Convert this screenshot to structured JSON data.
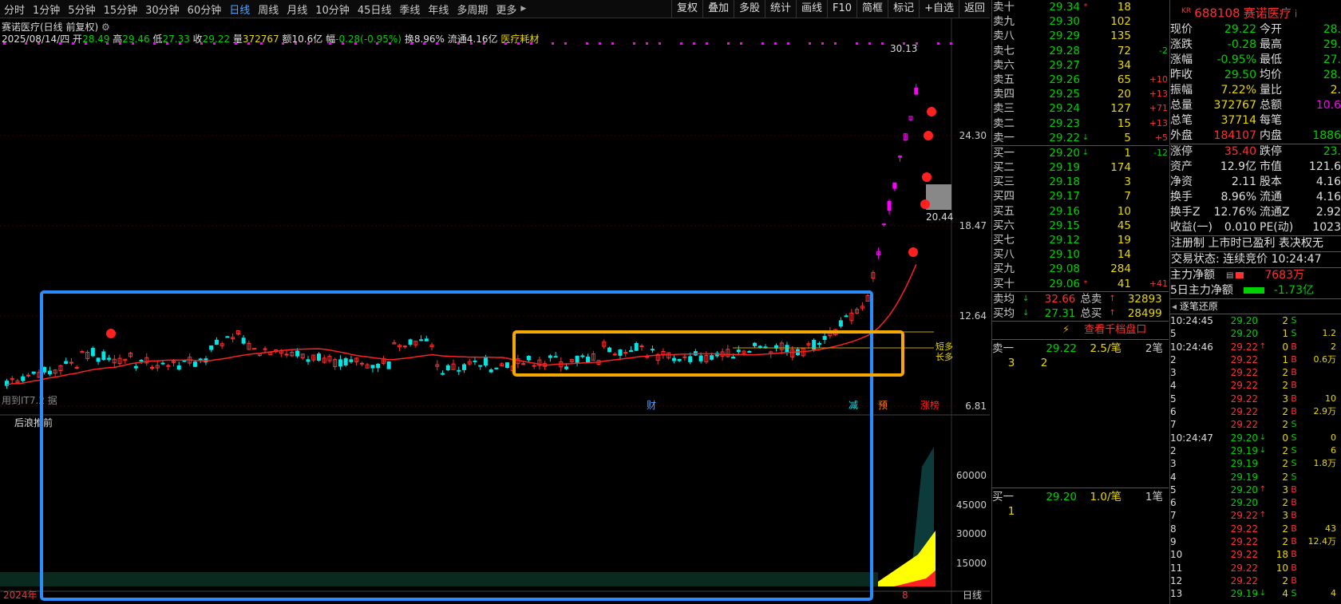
{
  "toolbar": {
    "timeframes": [
      "分时",
      "1分钟",
      "5分钟",
      "15分钟",
      "30分钟",
      "60分钟",
      "日线",
      "周线",
      "月线",
      "10分钟",
      "45日线",
      "季线",
      "年线",
      "多周期",
      "更多"
    ],
    "active_timeframe": "日线",
    "more_arrow": "▶",
    "tools": [
      "复权",
      "叠加",
      "多股",
      "统计",
      "画线",
      "F10",
      "简框",
      "标记",
      "+自选",
      "返回"
    ]
  },
  "chart_header": {
    "title": "赛诺医疗(日线 前复权)",
    "date": "2025/08/14/四",
    "open_label": "开",
    "open": "28.49",
    "high_label": "高",
    "high": "29.46",
    "low_label": "低",
    "low": "27.33",
    "close_label": "收",
    "close": "29.22",
    "vol_label": "量",
    "vol": "372767",
    "amount_label": "额",
    "amount": "10.6亿",
    "chg_label": "幅",
    "chg": "-0.28(-0.95%)",
    "turnover_label": "换",
    "turnover": "8.96%",
    "float_label": "流通",
    "float": "4.16亿",
    "sector": "医疗耗材"
  },
  "chart": {
    "y_ticks": [
      "24.30",
      "18.47",
      "12.64",
      "6.81"
    ],
    "peak_label": "30.13",
    "low_label": "20.44",
    "x_start": "2024年",
    "x_mark": "8",
    "event_cai": "财",
    "event_jian": "减",
    "event_yu": "预",
    "event_zt": "涨榜",
    "bottom_text": "用到IT7.2 据",
    "lower_title": "后浪推前",
    "lower_y_ticks": [
      "60000",
      "45000",
      "30000",
      "15000"
    ],
    "side_labels": [
      "短多",
      "长多"
    ],
    "footer_right": "日线",
    "colors": {
      "up": "#ff3030",
      "down": "#00e5e5",
      "ma": "#ff2020",
      "box_blue": "#2a8cff",
      "box_orange": "#f5a800"
    }
  },
  "order_book": {
    "sells": [
      {
        "label": "卖十",
        "price": "29.34",
        "arr": "*",
        "vol": "18",
        "chg": ""
      },
      {
        "label": "卖九",
        "price": "29.30",
        "arr": "",
        "vol": "102",
        "chg": ""
      },
      {
        "label": "卖八",
        "price": "29.29",
        "arr": "",
        "vol": "135",
        "chg": ""
      },
      {
        "label": "卖七",
        "price": "29.28",
        "arr": "",
        "vol": "72",
        "chg": "-2"
      },
      {
        "label": "卖六",
        "price": "29.27",
        "arr": "",
        "vol": "34",
        "chg": ""
      },
      {
        "label": "卖五",
        "price": "29.26",
        "arr": "",
        "vol": "65",
        "chg": "+10"
      },
      {
        "label": "卖四",
        "price": "29.25",
        "arr": "",
        "vol": "20",
        "chg": "+13"
      },
      {
        "label": "卖三",
        "price": "29.24",
        "arr": "",
        "vol": "127",
        "chg": "+71"
      },
      {
        "label": "卖二",
        "price": "29.23",
        "arr": "",
        "vol": "15",
        "chg": "+13"
      },
      {
        "label": "卖一",
        "price": "29.22",
        "arr": "↓",
        "vol": "5",
        "chg": "+5"
      }
    ],
    "buys": [
      {
        "label": "买一",
        "price": "29.20",
        "arr": "↓",
        "vol": "1",
        "chg": "-12"
      },
      {
        "label": "买二",
        "price": "29.19",
        "arr": "",
        "vol": "174",
        "chg": ""
      },
      {
        "label": "买三",
        "price": "29.18",
        "arr": "",
        "vol": "3",
        "chg": ""
      },
      {
        "label": "买四",
        "price": "29.17",
        "arr": "",
        "vol": "7",
        "chg": ""
      },
      {
        "label": "买五",
        "price": "29.16",
        "arr": "",
        "vol": "10",
        "chg": ""
      },
      {
        "label": "买六",
        "price": "29.15",
        "arr": "",
        "vol": "45",
        "chg": ""
      },
      {
        "label": "买七",
        "price": "29.12",
        "arr": "",
        "vol": "19",
        "chg": ""
      },
      {
        "label": "买八",
        "price": "29.10",
        "arr": "",
        "vol": "14",
        "chg": ""
      },
      {
        "label": "买九",
        "price": "29.08",
        "arr": "",
        "vol": "284",
        "chg": ""
      },
      {
        "label": "买十",
        "price": "29.06",
        "arr": "*",
        "vol": "41",
        "chg": "+41"
      }
    ],
    "avg_sell_label": "卖均",
    "avg_sell": "32.66",
    "total_sell_label": "总卖",
    "total_sell": "32893",
    "avg_buy_label": "买均",
    "avg_buy": "27.31",
    "total_buy_label": "总买",
    "total_buy": "28499",
    "thousand_link": "查看千档盘口",
    "sell1_label": "卖一",
    "sell1_price": "29.22",
    "sell1_per": "2.5/笔",
    "sell1_count": "2笔",
    "sell1_q1": "3",
    "sell1_q2": "2",
    "buy1_label": "买一",
    "buy1_price": "29.20",
    "buy1_per": "1.0/笔",
    "buy1_count": "1笔",
    "buy1_q1": "1"
  },
  "quote": {
    "code": "688108",
    "name": "赛诺医疗",
    "kr": "KR",
    "info_icon": "i",
    "rows": [
      [
        "现价",
        "29.22",
        "今开",
        "28."
      ],
      [
        "涨跌",
        "-0.28",
        "最高",
        "29."
      ],
      [
        "涨幅",
        "-0.95%",
        "最低",
        "27."
      ],
      [
        "昨收",
        "29.50",
        "均价",
        "28."
      ],
      [
        "振幅",
        "7.22%",
        "量比",
        "2."
      ],
      [
        "总量",
        "372767",
        "总额",
        "10.6"
      ],
      [
        "总笔",
        "37714",
        "每笔",
        ""
      ],
      [
        "外盘",
        "184107",
        "内盘",
        "1886"
      ]
    ],
    "rows2": [
      [
        "涨停",
        "35.40",
        "跌停",
        "23."
      ],
      [
        "资产",
        "12.9亿",
        "市值",
        "121.6"
      ],
      [
        "净资",
        "2.11",
        "股本",
        "4.16"
      ],
      [
        "换手",
        "8.96%",
        "流通",
        "4.16"
      ],
      [
        "换手Z",
        "12.76%",
        "流通Z",
        "2.92"
      ],
      [
        "收益(一)",
        "0.010",
        "PE(动)",
        "1023"
      ]
    ],
    "reg_line": "注册制 上市时已盈利 表决权无",
    "trade_status": "交易状态: 连续竞价 10:24:47",
    "main_flow_label": "主力净额",
    "main_flow": "7683万",
    "main5_label": "5日主力净额",
    "main5": "-1.73亿",
    "ticks_title": "逐笔还原",
    "ticks": [
      [
        "10:24:45",
        "29.20",
        "",
        "2",
        "S",
        ""
      ],
      [
        "5",
        "29.20",
        "",
        "1",
        "S",
        "1.2"
      ],
      [
        "10:24:46",
        "29.22",
        "↑",
        "0",
        "B",
        "2"
      ],
      [
        "2",
        "29.22",
        "",
        "1",
        "B",
        "0.6万"
      ],
      [
        "3",
        "29.22",
        "",
        "2",
        "B",
        ""
      ],
      [
        "4",
        "29.22",
        "",
        "2",
        "B",
        ""
      ],
      [
        "5",
        "29.22",
        "",
        "3",
        "B",
        "10"
      ],
      [
        "6",
        "29.22",
        "",
        "2",
        "B",
        "2.9万"
      ],
      [
        "7",
        "29.22",
        "",
        "2",
        "S",
        ""
      ],
      [
        "10:24:47",
        "29.20",
        "↓",
        "0",
        "S",
        "0"
      ],
      [
        "2",
        "29.19",
        "↓",
        "2",
        "S",
        "6"
      ],
      [
        "3",
        "29.19",
        "",
        "2",
        "S",
        "1.8万"
      ],
      [
        "4",
        "29.19",
        "",
        "2",
        "S",
        ""
      ],
      [
        "5",
        "29.20",
        "↑",
        "3",
        "B",
        ""
      ],
      [
        "6",
        "29.20",
        "",
        "2",
        "B",
        ""
      ],
      [
        "7",
        "29.22",
        "↑",
        "3",
        "B",
        ""
      ],
      [
        "8",
        "29.22",
        "",
        "2",
        "B",
        "43"
      ],
      [
        "9",
        "29.22",
        "",
        "2",
        "B",
        "12.4万"
      ],
      [
        "10",
        "29.22",
        "",
        "18",
        "B",
        ""
      ],
      [
        "11",
        "29.22",
        "",
        "10",
        "B",
        ""
      ],
      [
        "12",
        "29.22",
        "",
        "2",
        "B",
        ""
      ],
      [
        "13",
        "29.19",
        "↓",
        "4",
        "S",
        "4"
      ]
    ]
  }
}
